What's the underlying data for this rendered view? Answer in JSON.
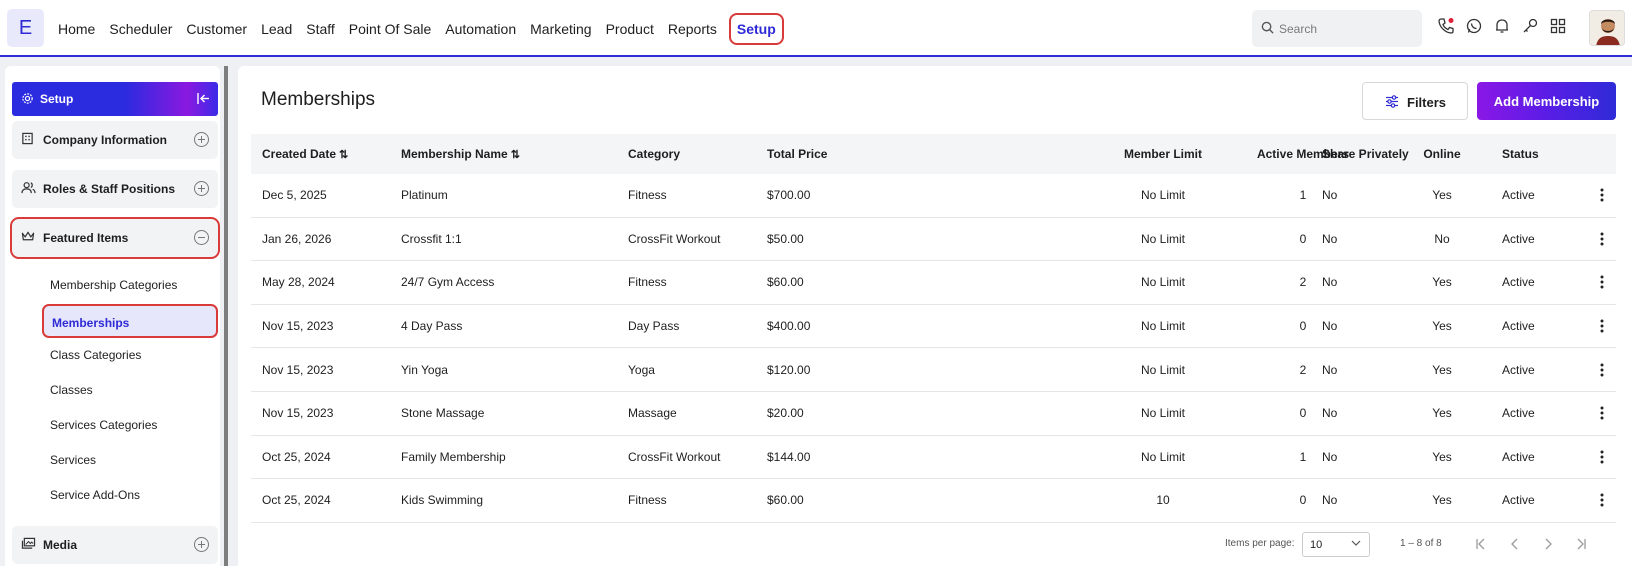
{
  "app": {
    "logo_letter": "E",
    "accent": "#2e2ad6",
    "highlight": "#d93a3a"
  },
  "nav": {
    "items": [
      "Home",
      "Scheduler",
      "Customer",
      "Lead",
      "Staff",
      "Point Of Sale",
      "Automation",
      "Marketing",
      "Product",
      "Reports",
      "Setup"
    ],
    "active": "Setup"
  },
  "search": {
    "placeholder": "Search"
  },
  "top_icons": [
    "phone-icon",
    "whatsapp-icon",
    "bell-icon",
    "key-icon",
    "grid-icon"
  ],
  "sidebar": {
    "header": "Setup",
    "sections": [
      {
        "label": "Company Information",
        "icon": "building-icon",
        "expanded": false
      },
      {
        "label": "Roles & Staff Positions",
        "icon": "users-icon",
        "expanded": false
      },
      {
        "label": "Featured Items",
        "icon": "crown-icon",
        "expanded": true
      },
      {
        "label": "Media",
        "icon": "media-icon",
        "expanded": false
      }
    ],
    "sub_items": [
      "Membership Categories",
      "Memberships",
      "Class Categories",
      "Classes",
      "Services Categories",
      "Services",
      "Service Add-Ons"
    ],
    "active_sub_item": "Memberships"
  },
  "main": {
    "title": "Memberships",
    "filters_label": "Filters",
    "add_label": "Add Membership",
    "columns": [
      "Created Date",
      "Membership Name",
      "Category",
      "Total Price",
      "Member Limit",
      "Active Members",
      "Online",
      "Share Privately",
      "Status"
    ],
    "rows": [
      {
        "date": "Dec 5, 2025",
        "name": "Platinum",
        "category": "Fitness",
        "price": "$700.00",
        "limit": "No Limit",
        "active": "1",
        "online": "Yes",
        "share": "No",
        "status": "Active"
      },
      {
        "date": "Jan 26, 2026",
        "name": "Crossfit 1:1",
        "category": "CrossFit Workout",
        "price": "$50.00",
        "limit": "No Limit",
        "active": "0",
        "online": "No",
        "share": "No",
        "status": "Active"
      },
      {
        "date": "May 28, 2024",
        "name": "24/7 Gym Access",
        "category": "Fitness",
        "price": "$60.00",
        "limit": "No Limit",
        "active": "2",
        "online": "Yes",
        "share": "No",
        "status": "Active"
      },
      {
        "date": "Nov 15, 2023",
        "name": "4 Day Pass",
        "category": "Day Pass",
        "price": "$400.00",
        "limit": "No Limit",
        "active": "0",
        "online": "Yes",
        "share": "No",
        "status": "Active"
      },
      {
        "date": "Nov 15, 2023",
        "name": "Yin Yoga",
        "category": "Yoga",
        "price": "$120.00",
        "limit": "No Limit",
        "active": "2",
        "online": "Yes",
        "share": "No",
        "status": "Active"
      },
      {
        "date": "Nov 15, 2023",
        "name": "Stone Massage",
        "category": "Massage",
        "price": "$20.00",
        "limit": "No Limit",
        "active": "0",
        "online": "Yes",
        "share": "No",
        "status": "Active"
      },
      {
        "date": "Oct 25, 2024",
        "name": "Family Membership",
        "category": "CrossFit Workout",
        "price": "$144.00",
        "limit": "No Limit",
        "active": "1",
        "online": "Yes",
        "share": "No",
        "status": "Active"
      },
      {
        "date": "Oct 25, 2024",
        "name": "Kids Swimming",
        "category": "Fitness",
        "price": "$60.00",
        "limit": "10",
        "active": "0",
        "online": "Yes",
        "share": "No",
        "status": "Active"
      }
    ]
  },
  "pagination": {
    "items_per_page_label": "Items per page:",
    "items_per_page": "10",
    "range": "1 – 8 of 8"
  }
}
